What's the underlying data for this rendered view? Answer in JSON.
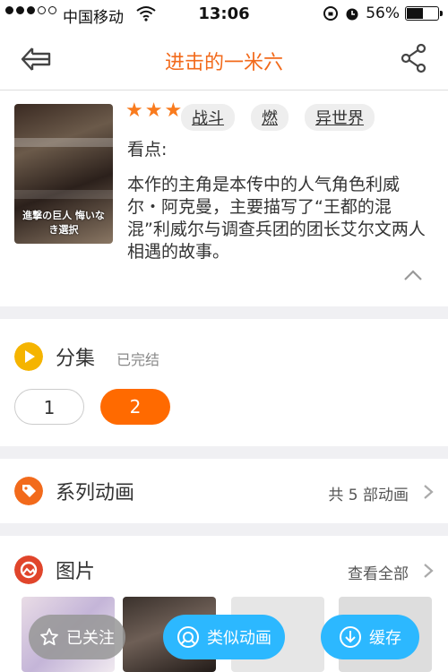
{
  "status": {
    "carrier": "中国移动",
    "time": "13:06",
    "battery": "56%",
    "battery_level": 0.56
  },
  "nav": {
    "title": "进击的一米六"
  },
  "info": {
    "rating": 3,
    "tags": [
      "战斗",
      "燃",
      "异世界"
    ],
    "label": "看点:",
    "description": "本作的主角是本传中的人气角色利威尔・阿克曼，主要描写了“王都的混混”利威尔与调查兵团的团长艾尔文两人相遇的故事。",
    "cover_caption": "進撃の巨人 悔いなき選択"
  },
  "episodes": {
    "title": "分集",
    "status": "已完结",
    "items": [
      "1",
      "2"
    ],
    "selected": "2"
  },
  "series": {
    "title": "系列动画",
    "more": "共 5 部动画"
  },
  "pictures": {
    "title": "图片",
    "more": "查看全部"
  },
  "buttons": {
    "follow": "已关注",
    "similar": "类似动画",
    "cache": "缓存"
  },
  "colors": {
    "accent": "#f26a1b",
    "selected_episode": "#ff6a00",
    "action_blue": "#2cb8ff",
    "play_icon": "#f5b400"
  }
}
